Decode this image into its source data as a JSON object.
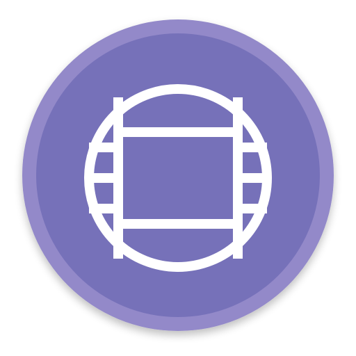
{
  "icon": {
    "name": "film-reel-icon",
    "colors": {
      "outer_ring": "#9389C9",
      "inner_disc": "#7671B9",
      "glyph": "#FFFFFF",
      "shadow": "#000000"
    }
  }
}
